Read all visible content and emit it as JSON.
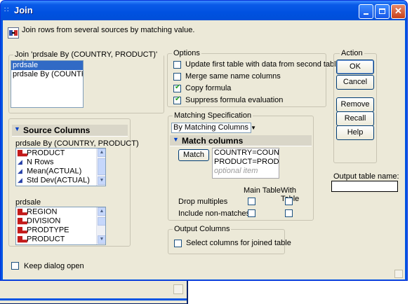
{
  "window": {
    "title": "Join",
    "instruction": "Join rows from several sources by matching value."
  },
  "join_with": {
    "label": "Join 'prdsale By (COUNTRY, PRODUCT)' with",
    "items": [
      "prdsale",
      "prdsale By (COUNTRY"
    ]
  },
  "source_columns": {
    "title": "Source Columns",
    "table1": {
      "name": "prdsale By (COUNTRY, PRODUCT)",
      "columns": [
        {
          "name": "PRODUCT",
          "icon": "nominal-icon"
        },
        {
          "name": "N Rows",
          "icon": "continuous-icon"
        },
        {
          "name": "Mean(ACTUAL)",
          "icon": "continuous-icon"
        },
        {
          "name": "Std Dev(ACTUAL)",
          "icon": "continuous-icon"
        }
      ]
    },
    "table2": {
      "name": "prdsale",
      "columns": [
        {
          "name": "REGION",
          "icon": "nominal-icon"
        },
        {
          "name": "DIVISION",
          "icon": "nominal-icon"
        },
        {
          "name": "PRODTYPE",
          "icon": "nominal-icon"
        },
        {
          "name": "PRODUCT",
          "icon": "nominal-icon"
        }
      ]
    }
  },
  "options": {
    "label": "Options",
    "items": [
      {
        "label": "Update first table with data from second table",
        "checked": false
      },
      {
        "label": "Merge same name columns",
        "checked": false
      },
      {
        "label": "Copy formula",
        "checked": true
      },
      {
        "label": "Suppress formula evaluation",
        "checked": true
      }
    ]
  },
  "action": {
    "label": "Action",
    "ok": "OK",
    "cancel": "Cancel",
    "remove": "Remove",
    "recall": "Recall",
    "help": "Help"
  },
  "matching": {
    "label": "Matching Specification",
    "method": "By Matching Columns",
    "match_columns_title": "Match columns",
    "match_button": "Match",
    "pairs": [
      "COUNTRY=COUNTR'",
      "PRODUCT=PRODUC"
    ],
    "optional": "optional item",
    "col_main": "Main Table",
    "col_with": "With Table",
    "drop_multiples": "Drop multiples",
    "include_nonmatches": "Include non-matches"
  },
  "output_table": {
    "label": "Output table name:",
    "value": ""
  },
  "output_columns": {
    "label": "Output Columns",
    "select_label": "Select columns for joined table"
  },
  "keep_open": "Keep dialog open"
}
